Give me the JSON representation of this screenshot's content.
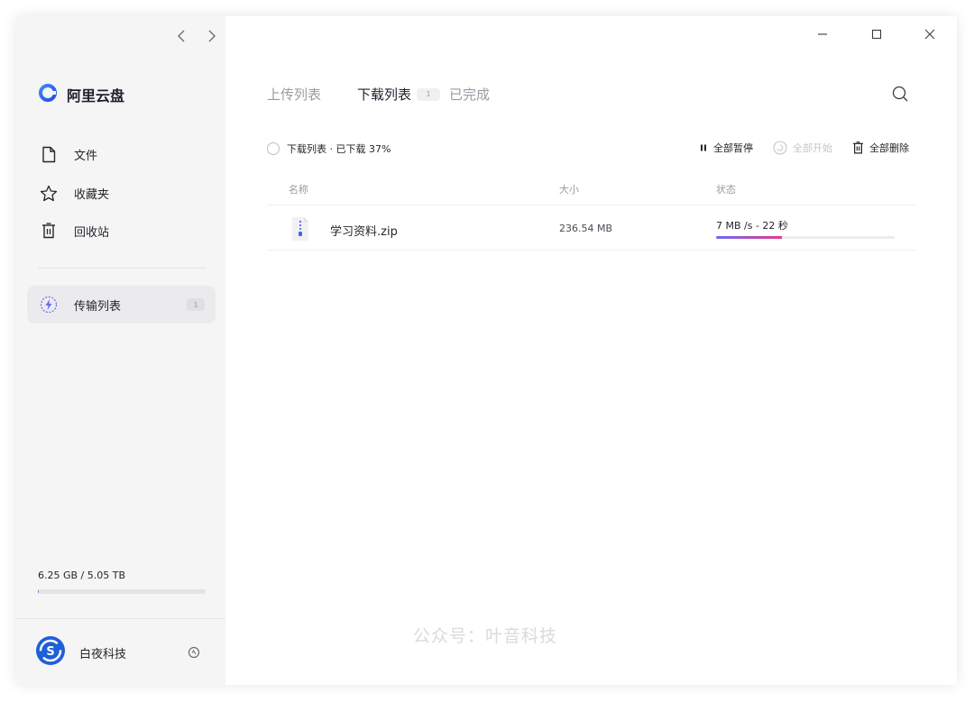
{
  "sidebar": {
    "logo_name": "阿里云盘",
    "items": [
      {
        "label": "文件",
        "icon": "file-icon"
      },
      {
        "label": "收藏夹",
        "icon": "star-icon"
      },
      {
        "label": "回收站",
        "icon": "trash-icon"
      }
    ],
    "transfer": {
      "label": "传输列表",
      "badge": "1",
      "icon": "lightning-icon"
    },
    "storage": {
      "text": "6.25 GB / 5.05 TB",
      "used_fraction": 0.0012
    },
    "user": {
      "name": "白夜科技"
    }
  },
  "main": {
    "tabs": [
      {
        "label": "上传列表"
      },
      {
        "label": "下载列表",
        "badge": "1"
      },
      {
        "label": "已完成"
      }
    ],
    "toolbar": {
      "select_label": "下载列表 · 已下载 37%",
      "pause_all": "全部暂停",
      "start_all": "全部开始",
      "delete_all": "全部删除"
    },
    "columns": {
      "name": "名称",
      "size": "大小",
      "status": "状态"
    },
    "rows": [
      {
        "name": "学习资料.zip",
        "size": "236.54 MB",
        "speed": "7 MB /s - 22 秒",
        "progress": 0.37
      }
    ]
  },
  "watermark": "公众号：叶音科技",
  "colors": {
    "accent": "#6a6bf0",
    "logo_blue": "#2f6cf6",
    "progress_end": "#e4398f"
  }
}
